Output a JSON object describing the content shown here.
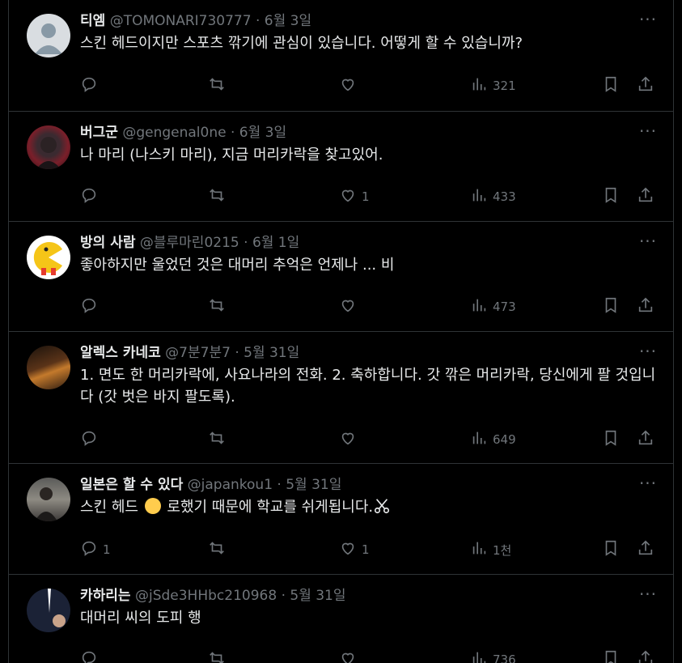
{
  "tweets": [
    {
      "name": "티엠",
      "handle": "@TOMONARI730777",
      "date": "6월 3일",
      "text": "스킨 헤드이지만 스포츠 깎기에 관심이 있습니다. 어떻게 할 수 있습니까?",
      "avatar": "default-avatar",
      "replies": "",
      "likes": "",
      "views": "321"
    },
    {
      "name": "버그군",
      "handle": "@gengenal0ne",
      "date": "6월 3일",
      "text": "나 마리 (나스키 마리), 지금 머리카락을 찾고있어.",
      "avatar": "red-foliage-photo",
      "replies": "",
      "likes": "1",
      "views": "433"
    },
    {
      "name": "방의 사람",
      "handle": "@블루마린0215",
      "date": "6월 1일",
      "text": "좋아하지만 울었던 것은 대머리 추억은 언제나 ... 비",
      "avatar": "pacman-figure",
      "replies": "",
      "likes": "",
      "views": "473"
    },
    {
      "name": "알렉스 카네코",
      "handle": "@7분7분7",
      "date": "5월 31일",
      "text": "1. 면도 한 머리카락에, 사요나라의 전화. 2. 축하합니다. 갓 깎은 머리카락, 당신에게 팔 것입니다 (갓 벗은 바지 팔도록).",
      "avatar": "night-bar-photo",
      "replies": "",
      "likes": "",
      "views": "649"
    },
    {
      "name": "일본은 할 수 있다",
      "handle": "@japankou1",
      "date": "5월 31일",
      "text_before": "스킨 헤드 ",
      "text_after": " 로했기 때문에 학교를 쉬게됩니다.",
      "text_emoji_1": "baby-face-emoji",
      "text_emoji_2": "scissors-emoji",
      "avatar": "person-photo",
      "replies": "1",
      "likes": "1",
      "views": "1천"
    },
    {
      "name": "카하리는",
      "handle": "@jSde3HHbc210968",
      "date": "5월 31일",
      "text": "대머리 씨의 도피 행",
      "avatar": "dark-jacket-photo",
      "replies": "",
      "likes": "",
      "views": "736"
    }
  ],
  "ui": {
    "dot": "·",
    "more": "···"
  },
  "colors": {
    "background": "#000000",
    "text": "#e7e9ea",
    "muted": "#71767b",
    "border": "#2f3336"
  },
  "icons": [
    "reply-icon",
    "retweet-icon",
    "like-icon",
    "views-icon",
    "bookmark-icon",
    "share-icon",
    "more-icon"
  ]
}
